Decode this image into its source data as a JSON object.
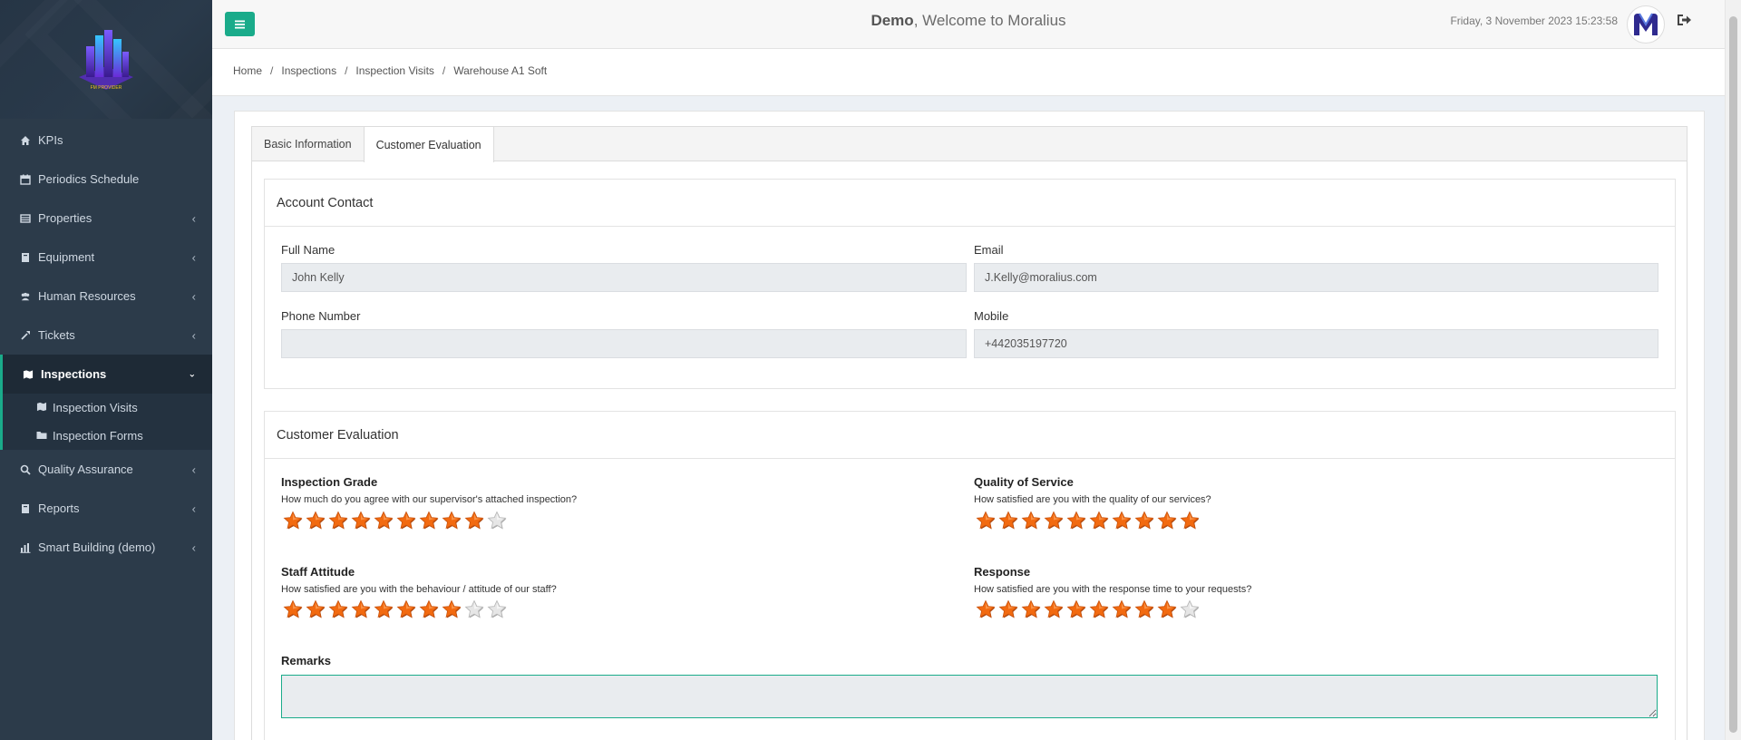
{
  "sidebar": {
    "logo_text": "FM PROVIDER",
    "items": [
      {
        "name": "kpis",
        "label": "KPIs",
        "icon": "home-icon",
        "chevron": false
      },
      {
        "name": "periodics-schedule",
        "label": "Periodics Schedule",
        "icon": "calendar-icon",
        "chevron": false
      },
      {
        "name": "properties",
        "label": "Properties",
        "icon": "building-icon",
        "chevron": true
      },
      {
        "name": "equipment",
        "label": "Equipment",
        "icon": "book-icon",
        "chevron": true
      },
      {
        "name": "human-resources",
        "label": "Human Resources",
        "icon": "users-icon",
        "chevron": true
      },
      {
        "name": "tickets",
        "label": "Tickets",
        "icon": "tools-icon",
        "chevron": true
      },
      {
        "name": "inspections",
        "label": "Inspections",
        "icon": "map-icon",
        "chevron": true,
        "active": true
      }
    ],
    "subitems": [
      {
        "name": "inspection-visits",
        "label": "Inspection Visits",
        "icon": "map-icon"
      },
      {
        "name": "inspection-forms",
        "label": "Inspection Forms",
        "icon": "folder-icon"
      }
    ],
    "items_after": [
      {
        "name": "quality-assurance",
        "label": "Quality Assurance",
        "icon": "search-icon",
        "chevron": true
      },
      {
        "name": "reports",
        "label": "Reports",
        "icon": "book-icon",
        "chevron": true
      },
      {
        "name": "smart-building",
        "label": "Smart Building (demo)",
        "icon": "chart-icon",
        "chevron": true
      }
    ]
  },
  "header": {
    "user": "Demo",
    "welcome": ", Welcome to Moralius",
    "datetime": "Friday, 3 November 2023 15:23:58"
  },
  "breadcrumb": [
    "Home",
    "Inspections",
    "Inspection Visits",
    "Warehouse A1 Soft"
  ],
  "tabs": {
    "basic": "Basic Information",
    "evaluation": "Customer Evaluation"
  },
  "contact": {
    "title": "Account Contact",
    "full_name_label": "Full Name",
    "full_name": "John Kelly",
    "email_label": "Email",
    "email": "J.Kelly@moralius.com",
    "phone_label": "Phone Number",
    "phone": "",
    "mobile_label": "Mobile",
    "mobile": "+442035197720"
  },
  "evaluation": {
    "title": "Customer Evaluation",
    "questions": [
      {
        "title": "Inspection Grade",
        "sub": "How much do you agree with our supervisor's attached inspection?",
        "rating": 9,
        "max": 10
      },
      {
        "title": "Quality of Service",
        "sub": "How satisfied are you with the quality of our services?",
        "rating": 10,
        "max": 10
      },
      {
        "title": "Staff Attitude",
        "sub": "How satisfied are you with the behaviour / attitude of our staff?",
        "rating": 8,
        "max": 10
      },
      {
        "title": "Response",
        "sub": "How satisfied are you with the response time to your requests?",
        "rating": 9,
        "max": 10
      }
    ],
    "remarks_label": "Remarks",
    "remarks": ""
  },
  "colors": {
    "accent": "#1aab8a",
    "sidebar": "#2c3b4a",
    "star_on": "#f26a10",
    "star_off": "#e6e6e6"
  }
}
